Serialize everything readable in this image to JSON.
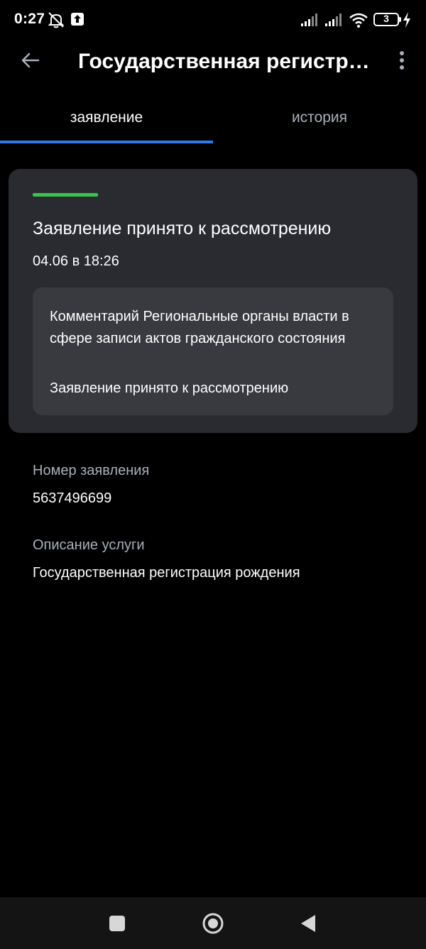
{
  "status_bar": {
    "time": "0:27",
    "battery_level": "3",
    "icons": [
      "mute-icon",
      "upload-icon",
      "signal-icon",
      "signal-icon",
      "wifi-icon",
      "battery-icon",
      "charging-icon"
    ]
  },
  "app_bar": {
    "title": "Государственная регистра..."
  },
  "tabs": [
    {
      "label": "заявление",
      "active": true
    },
    {
      "label": "история",
      "active": false
    }
  ],
  "status_card": {
    "title": "Заявление принято к рассмотрению",
    "date": "04.06 в 18:26",
    "status_color": "#39c34a",
    "comment": {
      "title": "Комментарий Региональные органы власти в сфере записи актов гражданского состояния",
      "text": "Заявление принято к рассмотрению"
    }
  },
  "details": {
    "application_number_label": "Номер заявления",
    "application_number": "5637496699",
    "service_description_label": "Описание услуги",
    "service_description": "Государственная регистрация рождения"
  },
  "colors": {
    "background": "#000000",
    "card": "#2a2b31",
    "comment_box": "#383a40",
    "accent": "#2f7ce8",
    "muted_text": "#a8b0bc"
  }
}
